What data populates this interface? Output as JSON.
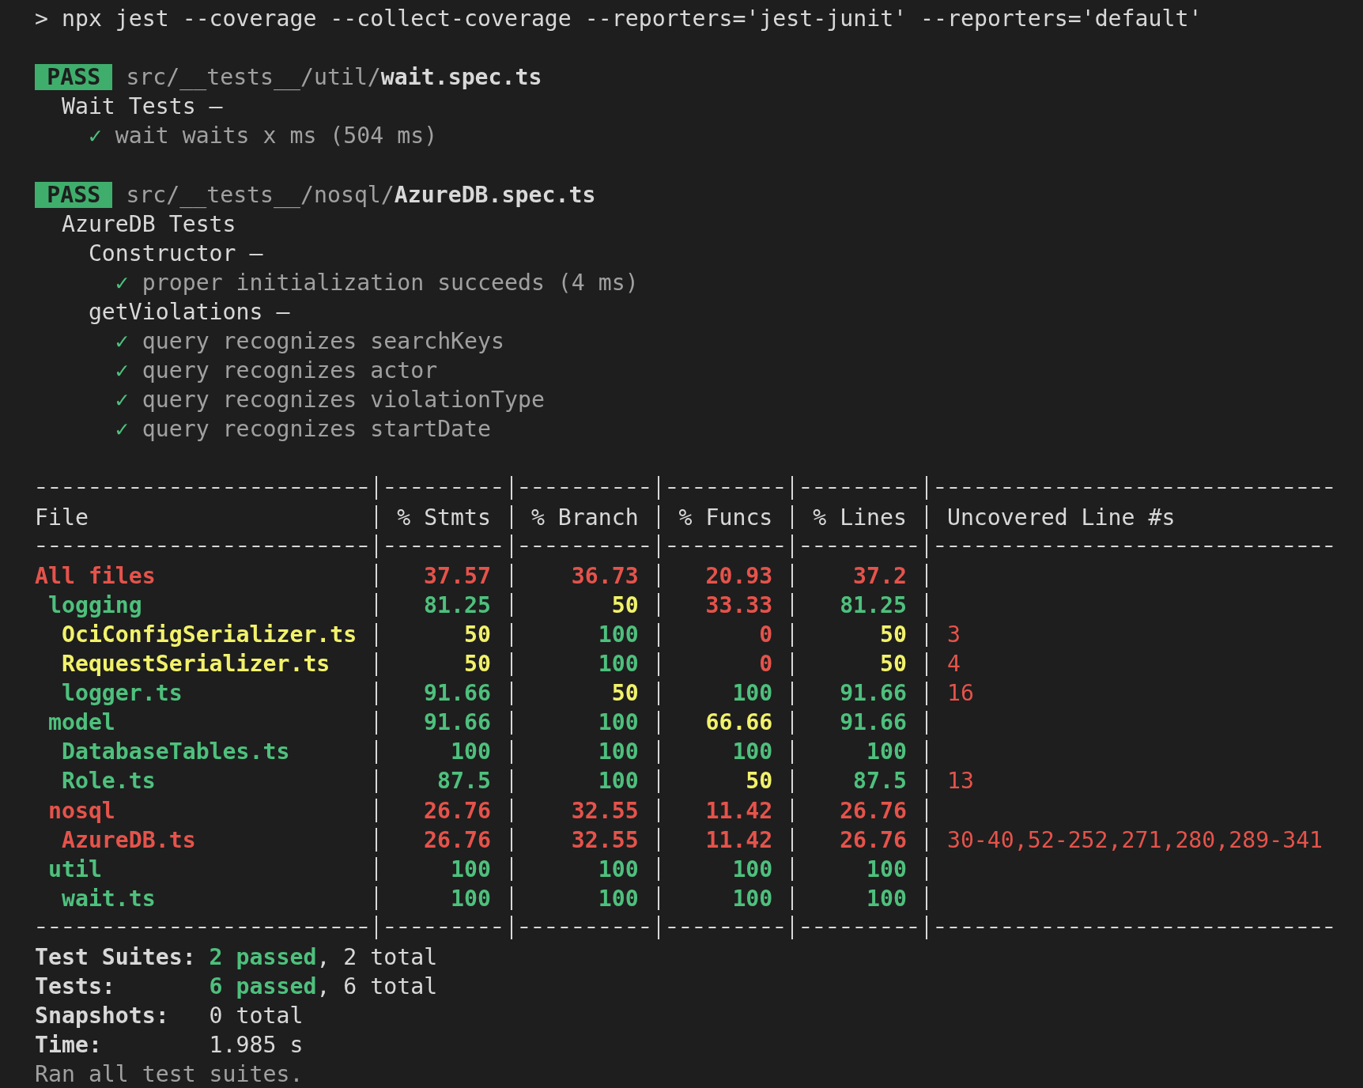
{
  "command": "> npx jest --coverage --collect-coverage --reporters='jest-junit' --reporters='default'",
  "suites": [
    {
      "status": "PASS",
      "path_dir": "src/__tests__/util/",
      "path_file": "wait.spec.ts",
      "describes": [
        {
          "title": "Wait Tests –",
          "tests": [
            {
              "mark": "✓",
              "passed": true,
              "name": "wait waits x ms (504 ms)"
            }
          ]
        }
      ]
    },
    {
      "status": "PASS",
      "path_dir": "src/__tests__/nosql/",
      "path_file": "AzureDB.spec.ts",
      "describes": [
        {
          "title": "AzureDB Tests",
          "children": [
            {
              "title": "Constructor –",
              "tests": [
                {
                  "mark": "✓",
                  "passed": true,
                  "name": "proper initialization succeeds (4 ms)"
                }
              ]
            },
            {
              "title": "getViolations –",
              "tests": [
                {
                  "mark": "✓",
                  "passed": true,
                  "name": "query recognizes searchKeys"
                },
                {
                  "mark": "✓",
                  "passed": true,
                  "name": "query recognizes actor"
                },
                {
                  "mark": "✓",
                  "passed": true,
                  "name": "query recognizes violationType"
                },
                {
                  "mark": "✓",
                  "passed": true,
                  "name": "query recognizes startDate"
                }
              ]
            }
          ]
        }
      ]
    }
  ],
  "table": {
    "columns": [
      "File",
      "% Stmts",
      "% Branch",
      "% Funcs",
      "% Lines",
      "Uncovered Line #s"
    ],
    "rows": [
      {
        "cells": [
          {
            "text": "All files",
            "color": "#e5534b"
          },
          {
            "text": "37.57",
            "color": "#e5534b"
          },
          {
            "text": "36.73",
            "color": "#e5534b"
          },
          {
            "text": "20.93",
            "color": "#e5534b"
          },
          {
            "text": "37.2",
            "color": "#e5534b"
          },
          {
            "text": ""
          }
        ],
        "children": [
          {
            "cells": [
              {
                "text": "logging",
                "color": "#4ec07d"
              },
              {
                "text": "81.25",
                "color": "#4ec07d"
              },
              {
                "text": "50",
                "color": "#f2f26b"
              },
              {
                "text": "33.33",
                "color": "#e5534b"
              },
              {
                "text": "81.25",
                "color": "#4ec07d"
              },
              {
                "text": ""
              }
            ],
            "children": [
              {
                "cells": [
                  {
                    "text": "OciConfigSerializer.ts",
                    "color": "#f2f26b"
                  },
                  {
                    "text": "50",
                    "color": "#f2f26b"
                  },
                  {
                    "text": "100",
                    "color": "#4ec07d"
                  },
                  {
                    "text": "0",
                    "color": "#e5534b"
                  },
                  {
                    "text": "50",
                    "color": "#f2f26b"
                  },
                  {
                    "text": "3",
                    "color": "#e5534b"
                  }
                ]
              },
              {
                "cells": [
                  {
                    "text": "RequestSerializer.ts",
                    "color": "#f2f26b"
                  },
                  {
                    "text": "50",
                    "color": "#f2f26b"
                  },
                  {
                    "text": "100",
                    "color": "#4ec07d"
                  },
                  {
                    "text": "0",
                    "color": "#e5534b"
                  },
                  {
                    "text": "50",
                    "color": "#f2f26b"
                  },
                  {
                    "text": "4",
                    "color": "#e5534b"
                  }
                ]
              },
              {
                "cells": [
                  {
                    "text": "logger.ts",
                    "color": "#4ec07d"
                  },
                  {
                    "text": "91.66",
                    "color": "#4ec07d"
                  },
                  {
                    "text": "50",
                    "color": "#f2f26b"
                  },
                  {
                    "text": "100",
                    "color": "#4ec07d"
                  },
                  {
                    "text": "91.66",
                    "color": "#4ec07d"
                  },
                  {
                    "text": "16",
                    "color": "#e5534b"
                  }
                ]
              }
            ]
          },
          {
            "cells": [
              {
                "text": "model",
                "color": "#4ec07d"
              },
              {
                "text": "91.66",
                "color": "#4ec07d"
              },
              {
                "text": "100",
                "color": "#4ec07d"
              },
              {
                "text": "66.66",
                "color": "#f2f26b"
              },
              {
                "text": "91.66",
                "color": "#4ec07d"
              },
              {
                "text": ""
              }
            ],
            "children": [
              {
                "cells": [
                  {
                    "text": "DatabaseTables.ts",
                    "color": "#4ec07d"
                  },
                  {
                    "text": "100",
                    "color": "#4ec07d"
                  },
                  {
                    "text": "100",
                    "color": "#4ec07d"
                  },
                  {
                    "text": "100",
                    "color": "#4ec07d"
                  },
                  {
                    "text": "100",
                    "color": "#4ec07d"
                  },
                  {
                    "text": ""
                  }
                ]
              },
              {
                "cells": [
                  {
                    "text": "Role.ts",
                    "color": "#4ec07d"
                  },
                  {
                    "text": "87.5",
                    "color": "#4ec07d"
                  },
                  {
                    "text": "100",
                    "color": "#4ec07d"
                  },
                  {
                    "text": "50",
                    "color": "#f2f26b"
                  },
                  {
                    "text": "87.5",
                    "color": "#4ec07d"
                  },
                  {
                    "text": "13",
                    "color": "#e5534b"
                  }
                ]
              }
            ]
          },
          {
            "cells": [
              {
                "text": "nosql",
                "color": "#e5534b"
              },
              {
                "text": "26.76",
                "color": "#e5534b"
              },
              {
                "text": "32.55",
                "color": "#e5534b"
              },
              {
                "text": "11.42",
                "color": "#e5534b"
              },
              {
                "text": "26.76",
                "color": "#e5534b"
              },
              {
                "text": ""
              }
            ],
            "children": [
              {
                "cells": [
                  {
                    "text": "AzureDB.ts",
                    "color": "#e5534b"
                  },
                  {
                    "text": "26.76",
                    "color": "#e5534b"
                  },
                  {
                    "text": "32.55",
                    "color": "#e5534b"
                  },
                  {
                    "text": "11.42",
                    "color": "#e5534b"
                  },
                  {
                    "text": "26.76",
                    "color": "#e5534b"
                  },
                  {
                    "text": "30-40,52-252,271,280,289-341",
                    "color": "#e5534b"
                  }
                ]
              }
            ]
          },
          {
            "cells": [
              {
                "text": "util",
                "color": "#4ec07d"
              },
              {
                "text": "100",
                "color": "#4ec07d"
              },
              {
                "text": "100",
                "color": "#4ec07d"
              },
              {
                "text": "100",
                "color": "#4ec07d"
              },
              {
                "text": "100",
                "color": "#4ec07d"
              },
              {
                "text": ""
              }
            ],
            "children": [
              {
                "cells": [
                  {
                    "text": "wait.ts",
                    "color": "#4ec07d"
                  },
                  {
                    "text": "100",
                    "color": "#4ec07d"
                  },
                  {
                    "text": "100",
                    "color": "#4ec07d"
                  },
                  {
                    "text": "100",
                    "color": "#4ec07d"
                  },
                  {
                    "text": "100",
                    "color": "#4ec07d"
                  },
                  {
                    "text": ""
                  }
                ]
              }
            ]
          }
        ]
      }
    ]
  },
  "summary": [
    {
      "label": "Test Suites:",
      "passed": "2 passed",
      "total": ", 2 total"
    },
    {
      "label": "Tests:",
      "passed": "6 passed",
      "total": ", 6 total"
    },
    {
      "label": "Snapshots:",
      "total": "0 total"
    },
    {
      "label": "Time:",
      "total": "1.985 s"
    }
  ],
  "footer": "Ran all test suites."
}
